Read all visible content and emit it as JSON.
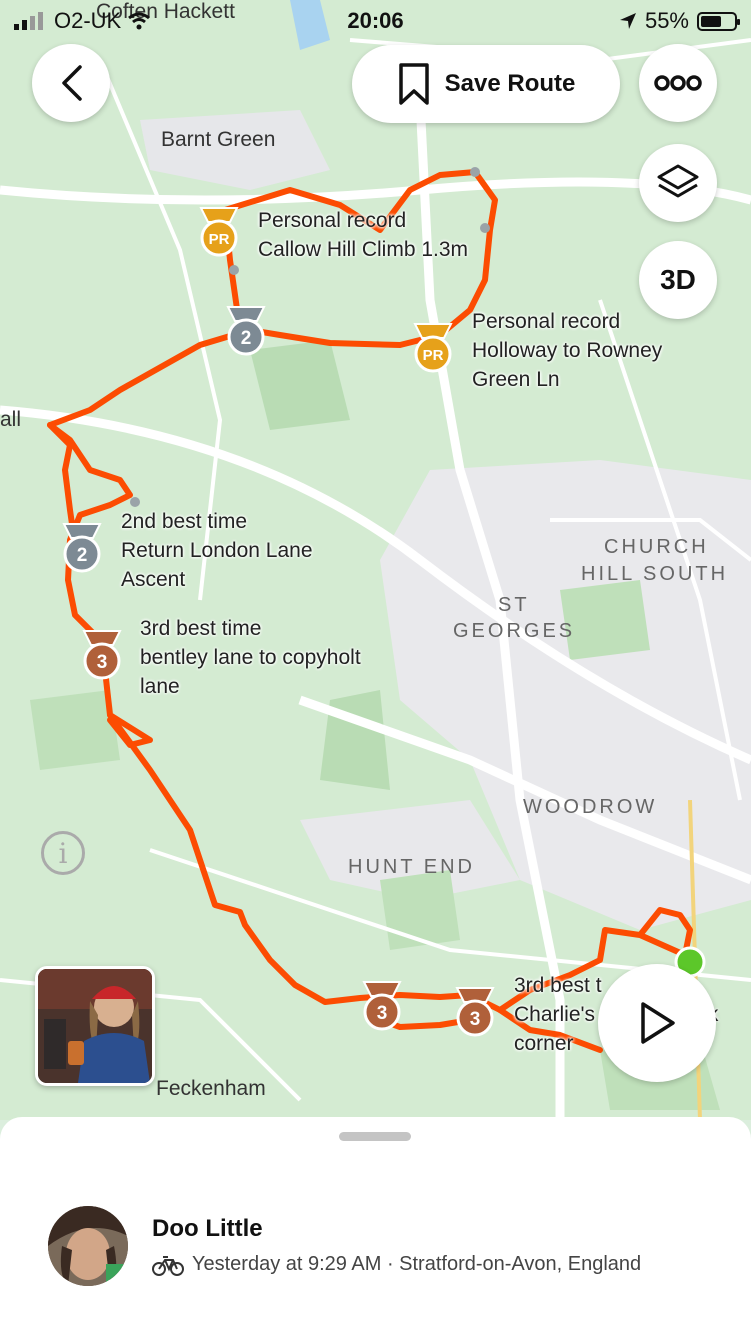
{
  "status": {
    "carrier": "O2-UK",
    "time": "20:06",
    "battery": "55%"
  },
  "top_bar": {
    "save_route_label": "Save Route",
    "view_3d_label": "3D"
  },
  "map_labels": {
    "coften_hackett": "Coften Hackett",
    "barnt_green": "Barnt Green",
    "all": "all",
    "church": "CHURCH",
    "hill_south": "HILL SOUTH",
    "st": "ST",
    "georges": "GEORGES",
    "woodrow": "WOODROW",
    "hunt_end": "HUNT END",
    "feckenham": "Feckenham"
  },
  "segments": {
    "callow": {
      "line1": "Personal record",
      "line2": "Callow Hill Climb 1.3m"
    },
    "holloway": {
      "line1": "Personal record",
      "line2": "Holloway to Rowney",
      "line3": "Green Ln"
    },
    "london_lane": {
      "line1": "2nd best time",
      "line2": "Return London Lane",
      "line3": "Ascent"
    },
    "bentley": {
      "line1": "3rd best time",
      "line2": "bentley lane to copyholt",
      "line3": "lane"
    },
    "charlie": {
      "line1": "3rd best t",
      "line2": "Charlie's",
      "line2b": "nick",
      "line3": "corner"
    }
  },
  "medals": {
    "pr": "PR",
    "second": "2",
    "third": "3"
  },
  "activity": {
    "athlete_name": "Doo Little",
    "meta_text": "Yesterday at 9:29 AM · Stratford-on-Avon, England"
  },
  "colors": {
    "route": "#fc4c02",
    "pr_gold": "#e6a11a",
    "silver": "#7d8a94",
    "bronze": "#b0603a"
  }
}
